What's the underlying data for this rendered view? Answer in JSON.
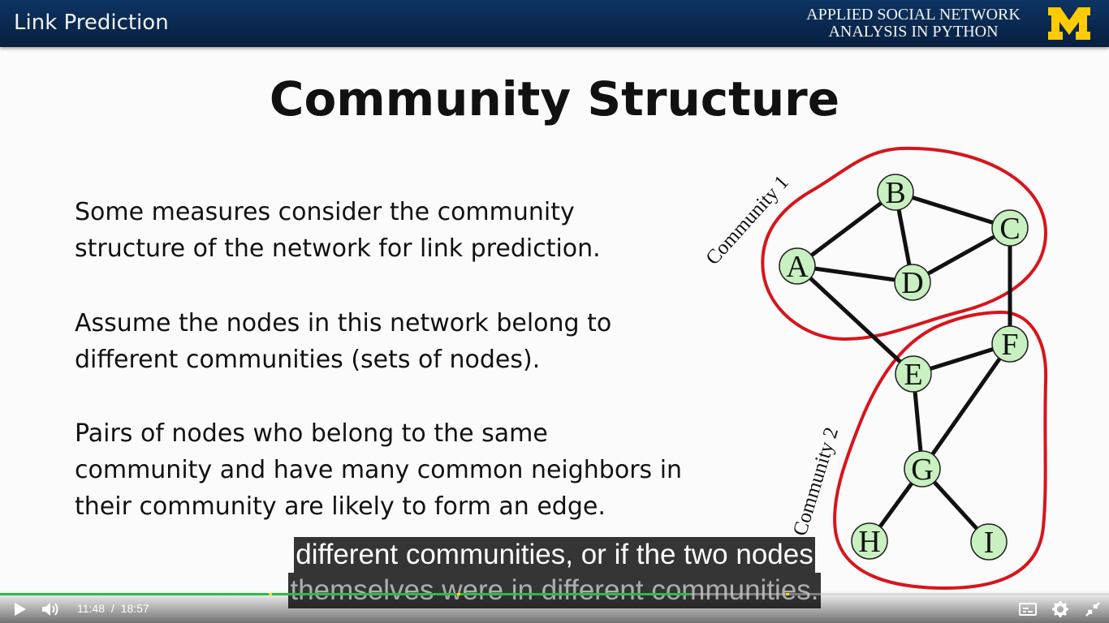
{
  "header": {
    "section_title": "Link Prediction",
    "course_title_line1": "APPLIED SOCIAL NETWORK",
    "course_title_line2": "ANALYSIS IN PYTHON",
    "logo_text": "M",
    "logo_color": "#ffcb05",
    "bar_color": "#0b2e59"
  },
  "slide": {
    "title": "Community Structure",
    "paragraphs": [
      [
        "Some measures consider the community",
        "structure of the network for link prediction."
      ],
      [
        "Assume the nodes in this network belong to",
        "different communities (sets of nodes)."
      ],
      [
        "Pairs of nodes who belong to the same",
        "community and have many common neighbors in",
        "their community are likely to form an edge."
      ]
    ]
  },
  "network": {
    "community_labels": [
      "Community 1",
      "Community 2"
    ],
    "nodes": [
      "A",
      "B",
      "C",
      "D",
      "E",
      "F",
      "G",
      "H",
      "I"
    ],
    "edges": [
      [
        "A",
        "B"
      ],
      [
        "A",
        "D"
      ],
      [
        "B",
        "D"
      ],
      [
        "B",
        "C"
      ],
      [
        "C",
        "D"
      ],
      [
        "C",
        "F"
      ],
      [
        "A",
        "E"
      ],
      [
        "E",
        "F"
      ],
      [
        "E",
        "G"
      ],
      [
        "F",
        "G"
      ],
      [
        "G",
        "H"
      ],
      [
        "G",
        "I"
      ]
    ],
    "node_fill": "#c8f0c0",
    "community_outline_color": "#d9141b"
  },
  "captions": {
    "line1": "different communities, or if the two nodes",
    "line2": "themselves were in different communities."
  },
  "player": {
    "current_time": "11:48",
    "separator": "/",
    "duration": "18:57",
    "progress_fraction": 0.622,
    "progress_color": "#2fb84a",
    "icons": [
      "play-icon",
      "volume-icon",
      "captions-icon",
      "settings-icon",
      "exit-fullscreen-icon"
    ]
  }
}
